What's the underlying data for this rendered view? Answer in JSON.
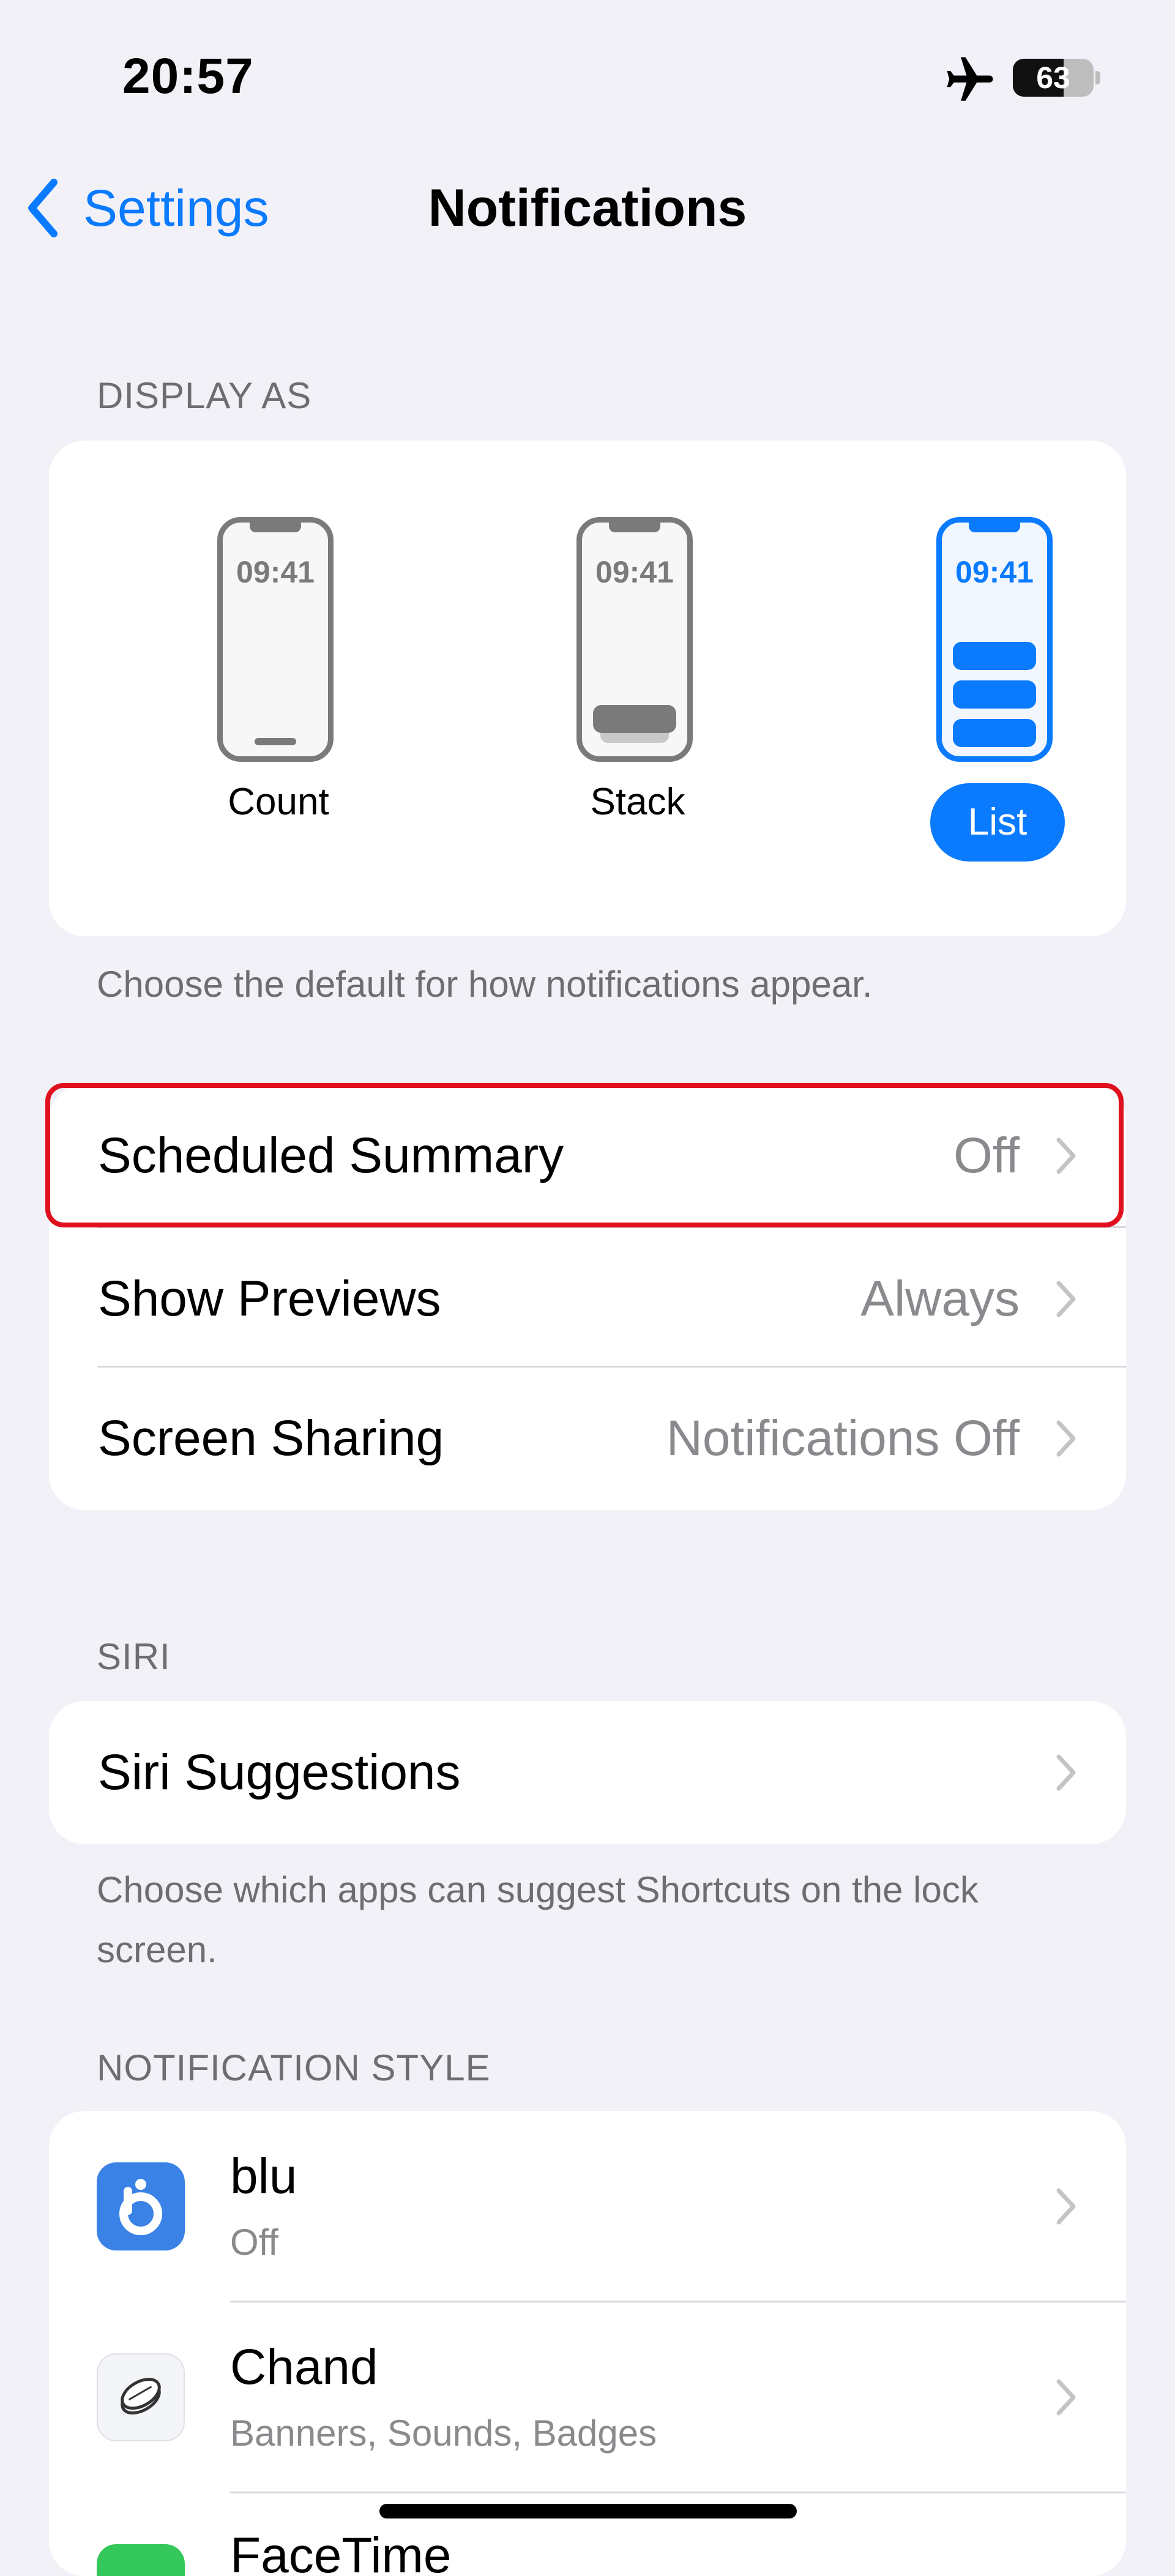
{
  "status_bar": {
    "time": "20:57",
    "battery": "63",
    "battery_level": 0.63
  },
  "nav": {
    "back_label": "Settings",
    "title": "Notifications"
  },
  "display_as": {
    "header": "DISPLAY AS",
    "options": [
      {
        "label": "Count",
        "phone_time": "09:41",
        "selected": false
      },
      {
        "label": "Stack",
        "phone_time": "09:41",
        "selected": false
      },
      {
        "label": "List",
        "phone_time": "09:41",
        "selected": true
      }
    ],
    "footer": "Choose the default for how notifications appear."
  },
  "settings_rows": [
    {
      "label": "Scheduled Summary",
      "value": "Off"
    },
    {
      "label": "Show Previews",
      "value": "Always"
    },
    {
      "label": "Screen Sharing",
      "value": "Notifications Off"
    }
  ],
  "siri": {
    "header": "SIRI",
    "row_label": "Siri Suggestions",
    "footer": "Choose which apps can suggest Shortcuts on the lock screen."
  },
  "notification_style": {
    "header": "NOTIFICATION STYLE",
    "apps": [
      {
        "name": "blu",
        "subtitle": "Off",
        "icon": "blu-app-icon",
        "icon_color": "#3b82e6"
      },
      {
        "name": "Chand",
        "subtitle": "Banners, Sounds, Badges",
        "icon": "coin-app-icon",
        "icon_color": "#f4f5f8"
      },
      {
        "name": "FaceTime",
        "subtitle": "",
        "icon": "facetime-app-icon",
        "icon_color": "#34c759"
      }
    ]
  },
  "colors": {
    "accent": "#0a7aff",
    "background": "#f2f1f7",
    "highlight": "#e0101e"
  }
}
